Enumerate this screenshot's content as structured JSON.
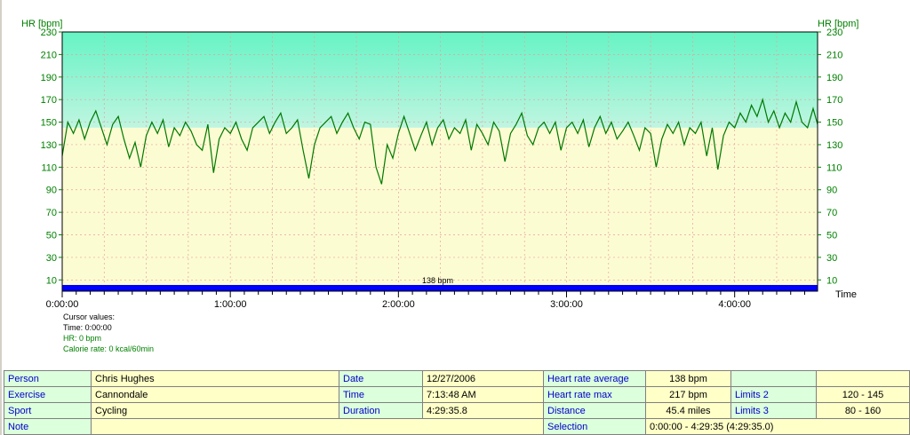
{
  "chart_data": {
    "type": "line",
    "ylabel_left": "HR [bpm]",
    "ylabel_right": "HR [bpm]",
    "xlabel": "Time",
    "ylim": [
      0,
      230
    ],
    "y_ticks": [
      10,
      30,
      50,
      70,
      90,
      110,
      130,
      150,
      170,
      190,
      210,
      230
    ],
    "y_tick_labels": [
      "10",
      "30",
      "50",
      "70",
      "90",
      "110",
      "130",
      "150",
      "170",
      "190",
      "210",
      "230"
    ],
    "x_range_seconds": [
      0,
      16175.8
    ],
    "x_tick_labels": [
      "0:00:00",
      "1:00:00",
      "2:00:00",
      "3:00:00",
      "4:00:00"
    ],
    "x_ticks_seconds": [
      0,
      3600,
      7200,
      10800,
      14400
    ],
    "upper_zone_from_bpm": 145,
    "average_line_bpm": 138,
    "average_label": "138 bpm",
    "grid": true,
    "series": [
      {
        "color": "#007800",
        "points": [
          [
            0,
            120
          ],
          [
            120,
            150
          ],
          [
            240,
            140
          ],
          [
            360,
            152
          ],
          [
            480,
            135
          ],
          [
            600,
            150
          ],
          [
            720,
            160
          ],
          [
            840,
            145
          ],
          [
            960,
            130
          ],
          [
            1080,
            148
          ],
          [
            1200,
            155
          ],
          [
            1320,
            135
          ],
          [
            1440,
            118
          ],
          [
            1560,
            132
          ],
          [
            1680,
            110
          ],
          [
            1800,
            138
          ],
          [
            1920,
            150
          ],
          [
            2040,
            140
          ],
          [
            2160,
            152
          ],
          [
            2280,
            128
          ],
          [
            2400,
            145
          ],
          [
            2520,
            138
          ],
          [
            2640,
            150
          ],
          [
            2760,
            142
          ],
          [
            2880,
            130
          ],
          [
            3000,
            125
          ],
          [
            3120,
            148
          ],
          [
            3240,
            105
          ],
          [
            3360,
            135
          ],
          [
            3480,
            145
          ],
          [
            3600,
            140
          ],
          [
            3720,
            150
          ],
          [
            3840,
            135
          ],
          [
            3960,
            125
          ],
          [
            4080,
            145
          ],
          [
            4200,
            150
          ],
          [
            4320,
            155
          ],
          [
            4440,
            140
          ],
          [
            4560,
            150
          ],
          [
            4680,
            158
          ],
          [
            4800,
            140
          ],
          [
            4920,
            145
          ],
          [
            5040,
            152
          ],
          [
            5160,
            125
          ],
          [
            5280,
            100
          ],
          [
            5400,
            130
          ],
          [
            5520,
            145
          ],
          [
            5640,
            150
          ],
          [
            5760,
            155
          ],
          [
            5880,
            140
          ],
          [
            6000,
            150
          ],
          [
            6120,
            158
          ],
          [
            6240,
            145
          ],
          [
            6360,
            135
          ],
          [
            6480,
            150
          ],
          [
            6600,
            148
          ],
          [
            6720,
            110
          ],
          [
            6840,
            95
          ],
          [
            6960,
            130
          ],
          [
            7080,
            118
          ],
          [
            7200,
            140
          ],
          [
            7320,
            155
          ],
          [
            7440,
            140
          ],
          [
            7560,
            125
          ],
          [
            7680,
            138
          ],
          [
            7800,
            150
          ],
          [
            7920,
            130
          ],
          [
            8040,
            145
          ],
          [
            8160,
            152
          ],
          [
            8280,
            135
          ],
          [
            8400,
            145
          ],
          [
            8520,
            140
          ],
          [
            8640,
            152
          ],
          [
            8760,
            125
          ],
          [
            8880,
            148
          ],
          [
            9000,
            140
          ],
          [
            9120,
            130
          ],
          [
            9240,
            150
          ],
          [
            9360,
            142
          ],
          [
            9480,
            115
          ],
          [
            9600,
            140
          ],
          [
            9720,
            148
          ],
          [
            9840,
            158
          ],
          [
            9960,
            138
          ],
          [
            10080,
            130
          ],
          [
            10200,
            145
          ],
          [
            10320,
            150
          ],
          [
            10440,
            140
          ],
          [
            10560,
            150
          ],
          [
            10680,
            125
          ],
          [
            10800,
            145
          ],
          [
            10920,
            150
          ],
          [
            11040,
            140
          ],
          [
            11160,
            152
          ],
          [
            11280,
            128
          ],
          [
            11400,
            145
          ],
          [
            11520,
            155
          ],
          [
            11640,
            140
          ],
          [
            11760,
            150
          ],
          [
            11880,
            135
          ],
          [
            12000,
            142
          ],
          [
            12120,
            150
          ],
          [
            12240,
            138
          ],
          [
            12360,
            125
          ],
          [
            12480,
            145
          ],
          [
            12600,
            140
          ],
          [
            12720,
            110
          ],
          [
            12840,
            135
          ],
          [
            12960,
            148
          ],
          [
            13080,
            140
          ],
          [
            13200,
            150
          ],
          [
            13320,
            130
          ],
          [
            13440,
            145
          ],
          [
            13560,
            140
          ],
          [
            13680,
            150
          ],
          [
            13800,
            120
          ],
          [
            13920,
            145
          ],
          [
            14040,
            108
          ],
          [
            14160,
            138
          ],
          [
            14280,
            150
          ],
          [
            14400,
            145
          ],
          [
            14520,
            158
          ],
          [
            14640,
            150
          ],
          [
            14760,
            165
          ],
          [
            14880,
            155
          ],
          [
            15000,
            170
          ],
          [
            15120,
            150
          ],
          [
            15240,
            160
          ],
          [
            15360,
            145
          ],
          [
            15480,
            158
          ],
          [
            15600,
            150
          ],
          [
            15720,
            168
          ],
          [
            15840,
            150
          ],
          [
            15960,
            145
          ],
          [
            16080,
            162
          ],
          [
            16175,
            148
          ]
        ]
      }
    ]
  },
  "cursor": {
    "title": "Cursor values:",
    "time": "Time: 0:00:00",
    "hr": "HR: 0 bpm",
    "calorie": "Calorie rate: 0 kcal/60min"
  },
  "info": {
    "rows": [
      [
        {
          "text": "Person",
          "type": "lbl"
        },
        {
          "text": "Chris Hughes",
          "type": "val"
        },
        {
          "text": "Date",
          "type": "lbl"
        },
        {
          "text": "12/27/2006",
          "type": "val"
        },
        {
          "text": "Heart rate average",
          "type": "lbl"
        },
        {
          "text": "138 bpm",
          "type": "val",
          "align": "center"
        },
        {
          "text": "",
          "type": "lbl"
        },
        {
          "text": "",
          "type": "val"
        }
      ],
      [
        {
          "text": "Exercise",
          "type": "lbl"
        },
        {
          "text": "Cannondale",
          "type": "val"
        },
        {
          "text": "Time",
          "type": "lbl"
        },
        {
          "text": "7:13:48 AM",
          "type": "val"
        },
        {
          "text": "Heart rate max",
          "type": "lbl"
        },
        {
          "text": "217 bpm",
          "type": "val",
          "align": "center"
        },
        {
          "text": "Limits 2",
          "type": "lbl"
        },
        {
          "text": "120 - 145",
          "type": "val",
          "align": "center"
        }
      ],
      [
        {
          "text": "Sport",
          "type": "lbl"
        },
        {
          "text": "Cycling",
          "type": "val"
        },
        {
          "text": "Duration",
          "type": "lbl"
        },
        {
          "text": "4:29:35.8",
          "type": "val"
        },
        {
          "text": "Distance",
          "type": "lbl"
        },
        {
          "text": "45.4 miles",
          "type": "val",
          "align": "center"
        },
        {
          "text": "Limits 3",
          "type": "lbl"
        },
        {
          "text": "80 - 160",
          "type": "val",
          "align": "center"
        }
      ],
      [
        {
          "text": "Note",
          "type": "lbl"
        },
        {
          "text": "",
          "type": "val",
          "span": 3
        },
        {
          "text": "Selection",
          "type": "lbl"
        },
        {
          "text": "0:00:00 - 4:29:35 (4:29:35.0)",
          "type": "val",
          "span": 3
        }
      ]
    ]
  },
  "colors": {
    "upper_zone_top": "#66f4c4",
    "upper_zone_bottom": "#bff5e1",
    "lower_zone": "#fcfcd2",
    "hr_line": "#007800",
    "avg_bar": "#0000ff",
    "grid": "#e8a0a0",
    "axis_text": "#008000"
  }
}
